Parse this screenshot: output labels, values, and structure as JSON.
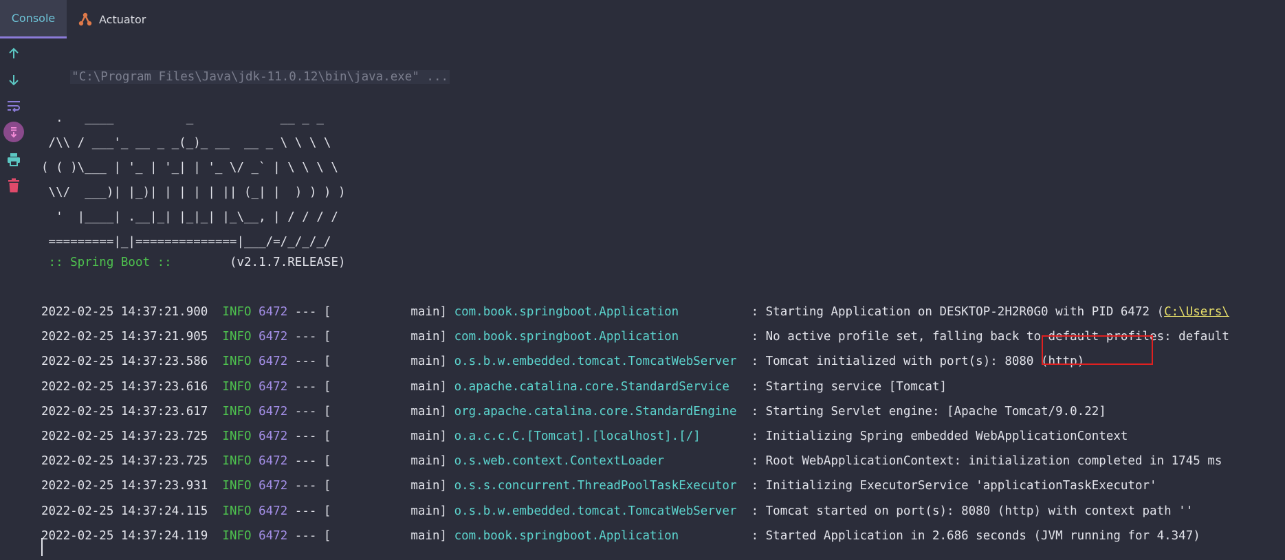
{
  "tabs": {
    "console": "Console",
    "actuator": "Actuator"
  },
  "toolbar_icons": [
    "arrow-up-icon",
    "arrow-down-icon",
    "soft-wrap-icon",
    "scroll-to-end-icon",
    "print-icon",
    "trash-icon"
  ],
  "colors": {
    "background": "#2b2d3a",
    "active_tab": "#3b3e4f",
    "accent": "#8b7bd8",
    "info": "#4ec24e",
    "pid": "#a48fe8",
    "logger": "#5cd5cf",
    "highlight_box": "#e02020"
  },
  "console": {
    "command": "\"C:\\Program Files\\Java\\jdk-11.0.12\\bin\\java.exe\" ...",
    "banner": [
      "  .   ____          _            __ _ _",
      " /\\\\ / ___'_ __ _ _(_)_ __  __ _ \\ \\ \\ \\",
      "( ( )\\___ | '_ | '_| | '_ \\/ _` | \\ \\ \\ \\",
      " \\\\/  ___)| |_)| | | | | || (_| |  ) ) ) )",
      "  '  |____| .__|_| |_|_| |_\\__, | / / / /",
      " =========|_|==============|___/=/_/_/_/"
    ],
    "spring_label": " :: Spring Boot :: ",
    "spring_version": "       (v2.1.7.RELEASE)",
    "logs": [
      {
        "ts": "2022-02-25 14:37:21.900",
        "level": "INFO",
        "pid": "6472",
        "thread": "--- [           main]",
        "logger": "com.book.springboot.Application",
        "msg": ": Starting Application on DESKTOP-2H2R0G0 with PID 6472 (",
        "path": "C:\\Users\\"
      },
      {
        "ts": "2022-02-25 14:37:21.905",
        "level": "INFO",
        "pid": "6472",
        "thread": "--- [           main]",
        "logger": "com.book.springboot.Application",
        "msg": ": No active profile set, falling back to default profiles: default",
        "path": ""
      },
      {
        "ts": "2022-02-25 14:37:23.586",
        "level": "INFO",
        "pid": "6472",
        "thread": "--- [           main]",
        "logger": "o.s.b.w.embedded.tomcat.TomcatWebServer",
        "msg": ": Tomcat initialized with port(s): 8080 (http)",
        "path": ""
      },
      {
        "ts": "2022-02-25 14:37:23.616",
        "level": "INFO",
        "pid": "6472",
        "thread": "--- [           main]",
        "logger": "o.apache.catalina.core.StandardService",
        "msg": ": Starting service [Tomcat]",
        "path": ""
      },
      {
        "ts": "2022-02-25 14:37:23.617",
        "level": "INFO",
        "pid": "6472",
        "thread": "--- [           main]",
        "logger": "org.apache.catalina.core.StandardEngine",
        "msg": ": Starting Servlet engine: [Apache Tomcat/9.0.22]",
        "path": ""
      },
      {
        "ts": "2022-02-25 14:37:23.725",
        "level": "INFO",
        "pid": "6472",
        "thread": "--- [           main]",
        "logger": "o.a.c.c.C.[Tomcat].[localhost].[/]",
        "msg": ": Initializing Spring embedded WebApplicationContext",
        "path": ""
      },
      {
        "ts": "2022-02-25 14:37:23.725",
        "level": "INFO",
        "pid": "6472",
        "thread": "--- [           main]",
        "logger": "o.s.web.context.ContextLoader",
        "msg": ": Root WebApplicationContext: initialization completed in 1745 ms",
        "path": ""
      },
      {
        "ts": "2022-02-25 14:37:23.931",
        "level": "INFO",
        "pid": "6472",
        "thread": "--- [           main]",
        "logger": "o.s.s.concurrent.ThreadPoolTaskExecutor",
        "msg": ": Initializing ExecutorService 'applicationTaskExecutor'",
        "path": ""
      },
      {
        "ts": "2022-02-25 14:37:24.115",
        "level": "INFO",
        "pid": "6472",
        "thread": "--- [           main]",
        "logger": "o.s.b.w.embedded.tomcat.TomcatWebServer",
        "msg": ": Tomcat started on port(s): 8080 (http) with context path ''",
        "path": ""
      },
      {
        "ts": "2022-02-25 14:37:24.119",
        "level": "INFO",
        "pid": "6472",
        "thread": "--- [           main]",
        "logger": "com.book.springboot.Application",
        "msg": ": Started Application in 2.686 seconds (JVM running for 4.347)",
        "path": ""
      }
    ]
  }
}
